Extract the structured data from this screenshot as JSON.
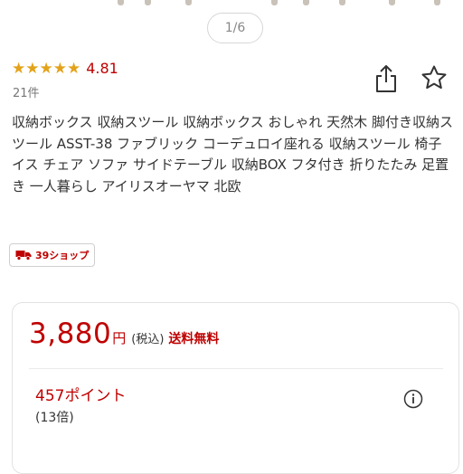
{
  "gallery": {
    "pager": "1/6"
  },
  "rating": {
    "stars": "★★★★★",
    "value": "4.81",
    "review_count": "21件"
  },
  "actions": {
    "share_icon": "share-icon",
    "favorite_icon": "star-outline-icon"
  },
  "product": {
    "title": "収納ボックス 収納スツール 収納ボックス おしゃれ 天然木 脚付き収納スツール ASST-38 ファブリック コーデュロイ座れる 収納スツール 椅子 イス チェア ソファ サイドテーブル 収納BOX フタ付き 折りたたみ 足置き 一人暮らし アイリスオーヤマ 北欧"
  },
  "shop_badge": {
    "icon": "truck-icon",
    "label": "39ショップ"
  },
  "price": {
    "amount": "3,880",
    "currency": "円",
    "tax": "(税込)",
    "shipping": "送料無料"
  },
  "points": {
    "amount": "457ポイント",
    "rate": "(13倍)",
    "info_icon": "info-icon"
  },
  "colors": {
    "accent_red": "#bf0000",
    "star_gold": "#e3a21a",
    "text": "#333333",
    "muted": "#777777"
  }
}
